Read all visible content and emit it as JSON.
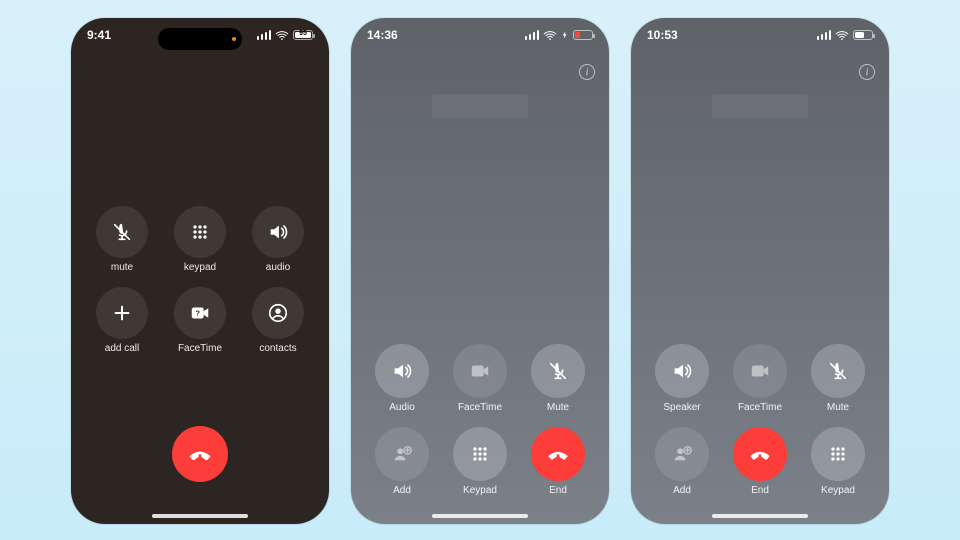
{
  "phoneA": {
    "time": "9:41",
    "battery": "95",
    "buttons": {
      "mute": "mute",
      "keypad": "keypad",
      "audio": "audio",
      "addcall": "add call",
      "facetime": "FaceTime",
      "contacts": "contacts"
    }
  },
  "phoneB": {
    "time": "14:36",
    "buttons": {
      "audio": "Audio",
      "facetime": "FaceTime",
      "mute": "Mute",
      "add": "Add",
      "keypad": "Keypad",
      "end": "End"
    }
  },
  "phoneC": {
    "time": "10:53",
    "buttons": {
      "speaker": "Speaker",
      "facetime": "FaceTime",
      "mute": "Mute",
      "add": "Add",
      "end": "End",
      "keypad": "Keypad"
    }
  }
}
